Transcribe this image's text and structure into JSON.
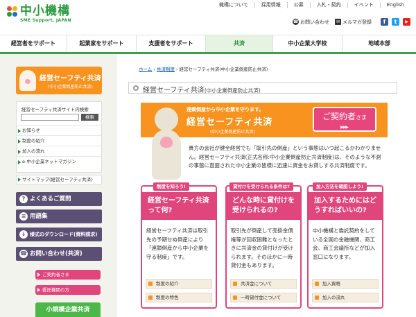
{
  "header": {
    "logo_title": "中小機構",
    "logo_sub": "SME Support, JAPAN",
    "top_links": [
      "機構について",
      "採用情報",
      "公募",
      "入札・契約",
      "イベント",
      "English"
    ],
    "row2_links": [
      {
        "label": "お問い合わせ",
        "icon": "phone-icon"
      },
      {
        "label": "メルマガ登録",
        "icon": "mail-icon"
      }
    ],
    "sns": [
      {
        "name": "facebook-icon",
        "glyph": "f",
        "color": "#3b5998"
      },
      {
        "name": "twitter-icon",
        "glyph": "t",
        "color": "#1da1f2"
      },
      {
        "name": "youtube-icon",
        "glyph": "▶",
        "color": "#e62117"
      }
    ]
  },
  "gnav": [
    "経営者をサポート",
    "起業家をサポート",
    "支援者をサポート",
    "共済",
    "中小企業大学校",
    "地域本部"
  ],
  "sidebar": {
    "banner_title": "経営セーフティ共済",
    "banner_sub": "(中小企業倒産防止共済)",
    "search_title": "経営セーフティ共済サイト内検索",
    "search_button": "検索",
    "search_value": "",
    "links": [
      "お知らせ",
      "制度の紹介",
      "加入の流れ",
      "e-中小企業ネットマガジン"
    ],
    "sitemap": "サイトマップ(経営セーフティ共済)",
    "gray_buttons": [
      {
        "label": "よくあるご質問",
        "icon": "question-icon",
        "glyph": "?"
      },
      {
        "label": "用語集",
        "icon": "book-icon",
        "glyph": "≡"
      },
      {
        "label": "様式のダウンロード(資料請求)",
        "icon": "download-icon",
        "glyph": "↓"
      },
      {
        "label": "お問い合わせ(共済)",
        "icon": "phone-icon",
        "glyph": "☎"
      }
    ],
    "pink_buttons": [
      "ご契約者さま",
      "委託機関の方"
    ],
    "green_banner": "小規模企業共済"
  },
  "breadcrumb": [
    "ホーム",
    "共済制度",
    "経営セーフティ共済(中小企業倒産防止共済)"
  ],
  "page_title": "経営セーフティ共済",
  "page_title_sub": "(中小企業倒産防止共済)",
  "hero": {
    "catch": "連鎖倒産から中小企業を守ります。",
    "title": "経営セーフティ共済",
    "sub": "(中小企業倒産防止共済)",
    "button_main": "ご契約者",
    "button_suffix": "さま",
    "button_arrows": "▶▶▶"
  },
  "intro": "貴方の会社が健全経営でも「取引先の倒産」という事態はいつ起こるかわかりません。経営セーフティ共済(正式名称:中小企業倒産防止共済制度)は、そのような不測の事態に直面された中小企業の皆様に迅速に資金をお貸しする共済制度です。",
  "cards": [
    {
      "tag": "制度を知ろう!",
      "title": "経営セーフティ共済って何?",
      "body": "経営セーフティ共済は取引先の予期せぬ倒産により「連鎖倒産から中小企業を守る制度」です。",
      "links": [
        "制度の紹介",
        "制度の特色"
      ]
    },
    {
      "tag": "貸付けを受けられる条件は?",
      "title": "どんな時に貸付けを受けられるの?",
      "body": "取引先が倒産して売掛金債権等が回収困難となったときに共済金の貸付けが受けられます。そのほかに一時貸付金もあります。",
      "links": [
        "共済金について",
        "一時貸付金について"
      ]
    },
    {
      "tag": "加入方法を確認しよう!",
      "title": "加入するためにはどうすればいいの?",
      "body": "中小機構と委託契約をしている全国の金融機関、商工会、商工会議所などが加入窓口になります。",
      "links": [
        "加入資格",
        "加入の流れ"
      ]
    }
  ],
  "colors": {
    "brand_green": "#2b9a3e",
    "orange": "#f7931e",
    "pink": "#e0457b",
    "purple_gray": "#5c4f74"
  }
}
